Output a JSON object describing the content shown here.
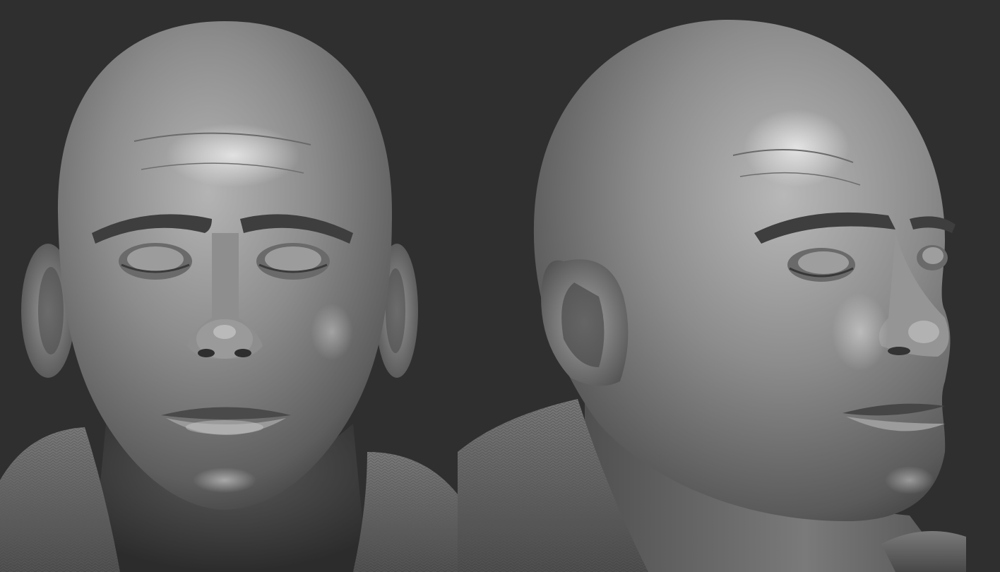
{
  "scene": {
    "background": "#2f2f2f",
    "material_base": "#8a8a8a",
    "material_highlight": "#d6d6d6",
    "material_shadow": "#2a2a2a"
  },
  "views": [
    {
      "id": "front",
      "icon": "bald-head-front-sculpt"
    },
    {
      "id": "three-quarter",
      "icon": "bald-head-three-quarter-sculpt"
    }
  ]
}
